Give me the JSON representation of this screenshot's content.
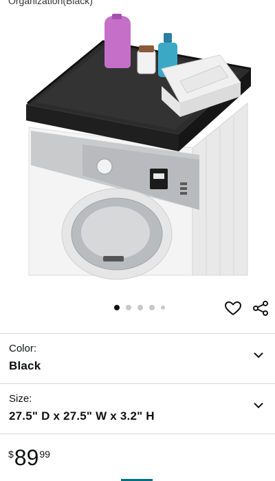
{
  "product": {
    "title_fragment": "Organization(Black)"
  },
  "gallery": {
    "image_count": 5,
    "active_index": 0
  },
  "actions": {
    "wishlist_icon": "heart-outline-icon",
    "share_icon": "share-icon"
  },
  "options": {
    "color": {
      "label": "Color:",
      "value": "Black"
    },
    "size": {
      "label": "Size:",
      "value": "27.5\" D x 27.5\" W x 3.2\" H"
    }
  },
  "price": {
    "symbol": "$",
    "whole": "89",
    "fraction": "99"
  },
  "colors": {
    "accent": "#007185",
    "dot_active": "#111111",
    "dot_inactive": "#c8c8c8",
    "divider": "#d5d9d9"
  }
}
